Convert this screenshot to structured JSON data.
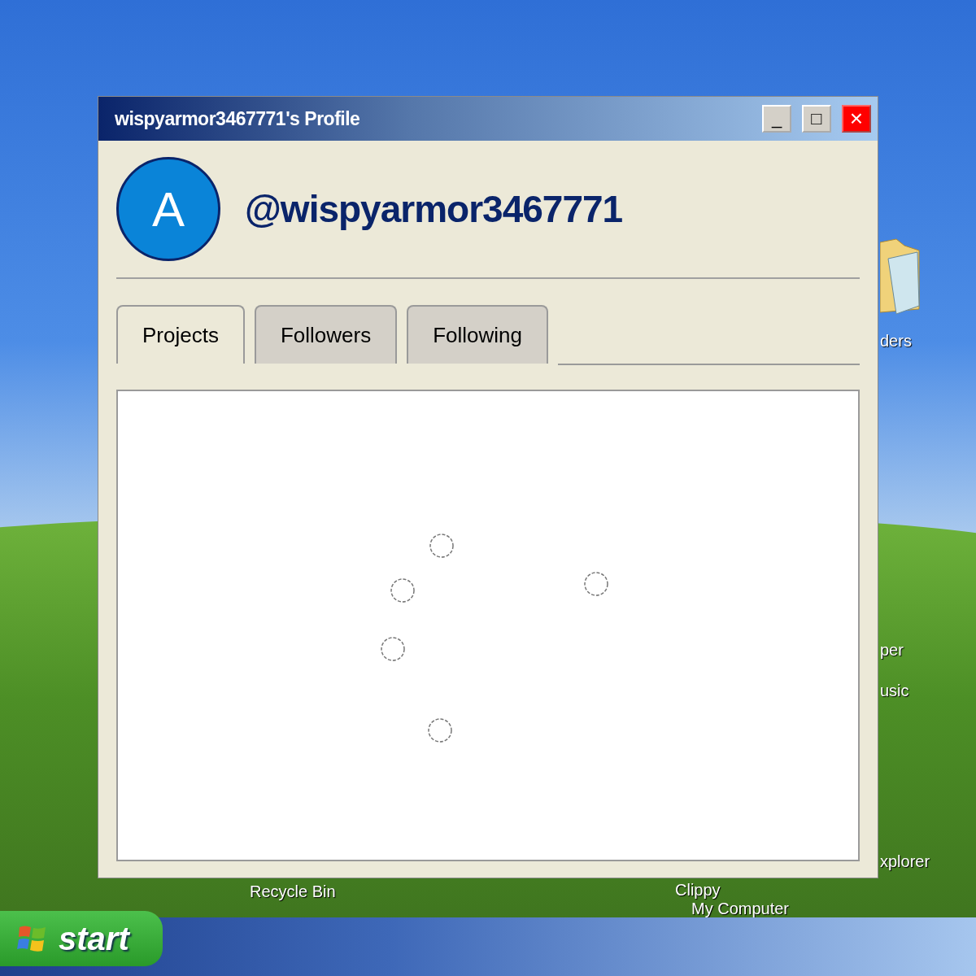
{
  "desktop": {
    "icon_labels": [
      "ders",
      "per",
      "usic",
      "xplorer",
      "Recycle Bin",
      "Clippy",
      "My Computer"
    ]
  },
  "window": {
    "title": "wispyarmor3467771's Profile",
    "controls": [
      "_",
      "□",
      "×"
    ]
  },
  "profile": {
    "avatar_letter": "A",
    "handle": "@wispyarmor3467771"
  },
  "tabs": [
    {
      "label": "Projects",
      "selected": true
    },
    {
      "label": "Followers",
      "selected": false
    },
    {
      "label": "Following",
      "selected": false
    }
  ],
  "taskbar": {
    "start_label": "start"
  }
}
